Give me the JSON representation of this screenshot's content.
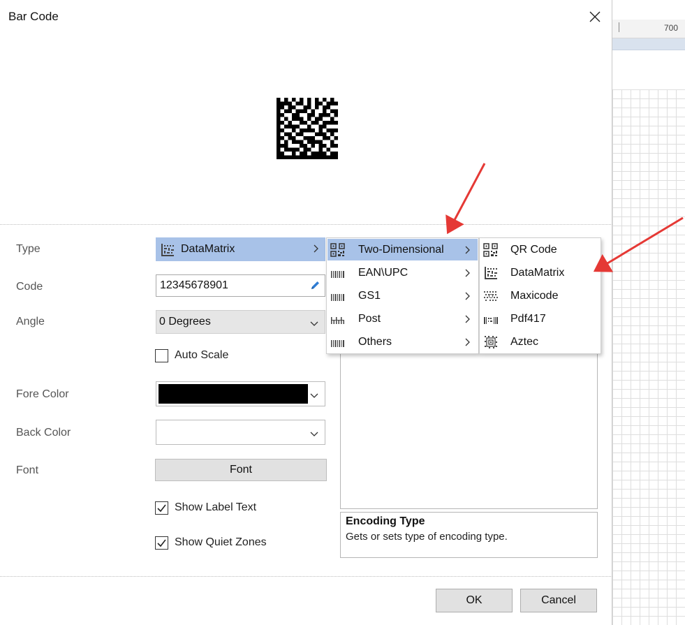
{
  "window": {
    "title": "Bar Code"
  },
  "background": {
    "ruler_value": "700"
  },
  "form": {
    "type_label": "Type",
    "type_value": "DataMatrix",
    "code_label": "Code",
    "code_value": "12345678901",
    "angle_label": "Angle",
    "angle_value": "0 Degrees",
    "auto_scale_label": "Auto Scale",
    "auto_scale_checked": false,
    "fore_color_label": "Fore Color",
    "fore_color_value": "#000000",
    "back_color_label": "Back Color",
    "back_color_value": "#ffffff",
    "font_label": "Font",
    "font_button": "Font",
    "show_label_text_label": "Show Label Text",
    "show_label_text_checked": true,
    "show_quiet_zones_label": "Show Quiet Zones",
    "show_quiet_zones_checked": true
  },
  "type_menu": {
    "items": [
      {
        "label": "Two-Dimensional",
        "icon": "qr-icon",
        "highlighted": true
      },
      {
        "label": "EAN\\UPC",
        "icon": "barcode-icon"
      },
      {
        "label": "GS1",
        "icon": "barcode-icon"
      },
      {
        "label": "Post",
        "icon": "postal-barcode-icon"
      },
      {
        "label": "Others",
        "icon": "barcode-icon"
      }
    ]
  },
  "submenu": {
    "items": [
      {
        "label": "QR Code",
        "icon": "qr-icon"
      },
      {
        "label": "DataMatrix",
        "icon": "datamatrix-icon"
      },
      {
        "label": "Maxicode",
        "icon": "maxicode-icon"
      },
      {
        "label": "Pdf417",
        "icon": "pdf417-icon"
      },
      {
        "label": "Aztec",
        "icon": "aztec-icon"
      }
    ]
  },
  "description": {
    "title": "Encoding Type",
    "text": "Gets or sets type of encoding type."
  },
  "buttons": {
    "ok": "OK",
    "cancel": "Cancel"
  },
  "colors": {
    "highlight": "#a8c2e8",
    "annotation_arrow": "#e53935"
  }
}
